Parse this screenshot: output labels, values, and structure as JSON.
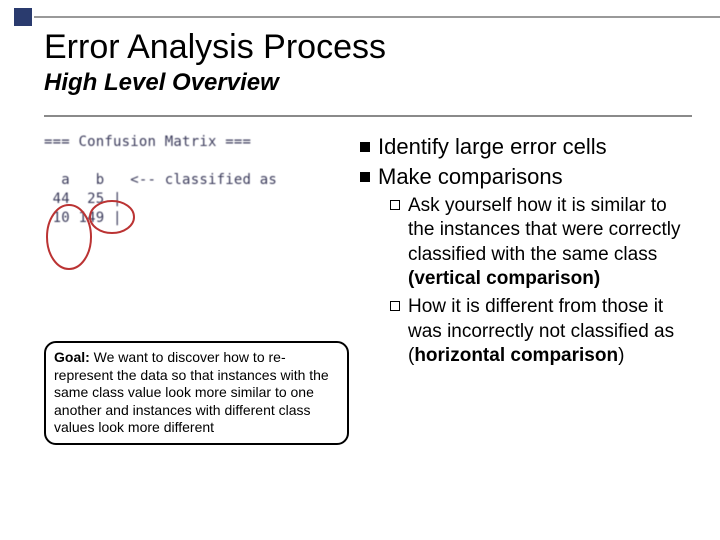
{
  "title": "Error Analysis Process",
  "subtitle": "High Level Overview",
  "matrix": {
    "header": "=== Confusion Matrix ===",
    "col_line": "  a   b   <-- classified as",
    "rows": [
      " 44  25 |",
      " 10 149 |"
    ]
  },
  "goal": {
    "label": "Goal:",
    "text": " We want to discover how to re-represent the data so that instances with the same class value look more similar to one another and instances with different class values look more different"
  },
  "bullets": [
    "Identify large error cells",
    "Make comparisons"
  ],
  "subpoints": {
    "ask": {
      "prefix": "Ask yourself how it is similar to the instances that were correctly classified with the same class ",
      "strong": "(vertical comparison)"
    },
    "how": {
      "prefix": "How it is different from those it was incorrectly not classified as (",
      "strong": "horizontal comparison",
      "suffix": ")"
    }
  }
}
